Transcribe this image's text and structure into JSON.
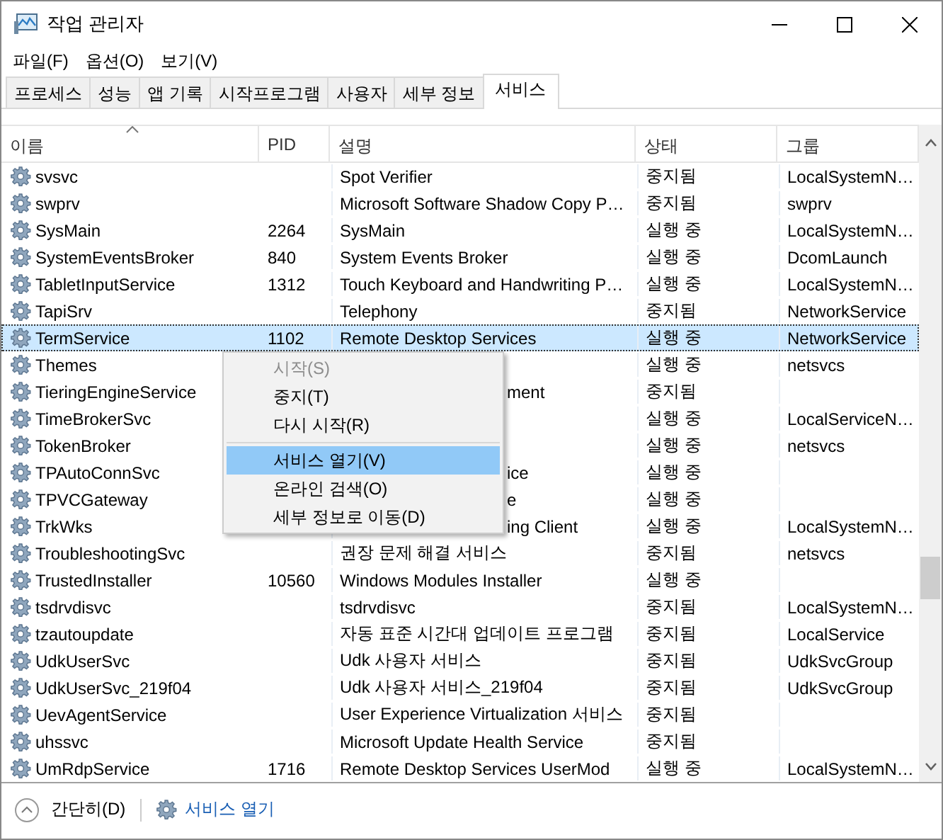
{
  "window": {
    "title": "작업 관리자"
  },
  "menu_bar": [
    "파일(F)",
    "옵션(O)",
    "보기(V)"
  ],
  "tabs": [
    {
      "label": "프로세스",
      "selected": false
    },
    {
      "label": "성능",
      "selected": false
    },
    {
      "label": "앱 기록",
      "selected": false
    },
    {
      "label": "시작프로그램",
      "selected": false
    },
    {
      "label": "사용자",
      "selected": false
    },
    {
      "label": "세부 정보",
      "selected": false
    },
    {
      "label": "서비스",
      "selected": true
    }
  ],
  "table": {
    "columns": [
      "이름",
      "PID",
      "설명",
      "상태",
      "그룹"
    ],
    "rows": [
      {
        "name": "svsvc",
        "pid": "",
        "description": "Spot Verifier",
        "status": "중지됨",
        "group": "LocalSystemN…",
        "selected": false
      },
      {
        "name": "swprv",
        "pid": "",
        "description": "Microsoft Software Shadow Copy P…",
        "status": "중지됨",
        "group": "swprv",
        "selected": false
      },
      {
        "name": "SysMain",
        "pid": "2264",
        "description": "SysMain",
        "status": "실행 중",
        "group": "LocalSystemN…",
        "selected": false
      },
      {
        "name": "SystemEventsBroker",
        "pid": "840",
        "description": "System Events Broker",
        "status": "실행 중",
        "group": "DcomLaunch",
        "selected": false
      },
      {
        "name": "TabletInputService",
        "pid": "1312",
        "description": "Touch Keyboard and Handwriting P…",
        "status": "실행 중",
        "group": "LocalSystemN…",
        "selected": false
      },
      {
        "name": "TapiSrv",
        "pid": "",
        "description": "Telephony",
        "status": "중지됨",
        "group": "NetworkService",
        "selected": false
      },
      {
        "name": "TermService",
        "pid": "1102",
        "description": "Remote Desktop Services",
        "status": "실행 중",
        "group": "NetworkService",
        "selected": true
      },
      {
        "name": "Themes",
        "pid": "",
        "description": "",
        "status": "실행 중",
        "group": "netsvcs",
        "selected": false
      },
      {
        "name": "TieringEngineService",
        "pid": "",
        "description": "ment",
        "description_cut": true,
        "status": "중지됨",
        "group": "",
        "selected": false
      },
      {
        "name": "TimeBrokerSvc",
        "pid": "",
        "description": "",
        "status": "실행 중",
        "group": "LocalServiceN…",
        "selected": false
      },
      {
        "name": "TokenBroker",
        "pid": "",
        "description": "",
        "status": "실행 중",
        "group": "netsvcs",
        "selected": false
      },
      {
        "name": "TPAutoConnSvc",
        "pid": "",
        "description": "ice",
        "description_cut": true,
        "status": "실행 중",
        "group": "",
        "selected": false
      },
      {
        "name": "TPVCGateway",
        "pid": "",
        "description": "e",
        "description_cut": true,
        "status": "실행 중",
        "group": "",
        "selected": false
      },
      {
        "name": "TrkWks",
        "pid": "",
        "description": "ing Client",
        "description_cut": true,
        "status": "실행 중",
        "group": "LocalSystemN…",
        "selected": false
      },
      {
        "name": "TroubleshootingSvc",
        "pid": "",
        "description": "권장 문제 해결 서비스",
        "status": "중지됨",
        "group": "netsvcs",
        "selected": false
      },
      {
        "name": "TrustedInstaller",
        "pid": "10560",
        "description": "Windows Modules Installer",
        "status": "실행 중",
        "group": "",
        "selected": false
      },
      {
        "name": "tsdrvdisvc",
        "pid": "",
        "description": "tsdrvdisvc",
        "status": "중지됨",
        "group": "LocalSystemN…",
        "selected": false
      },
      {
        "name": "tzautoupdate",
        "pid": "",
        "description": "자동 표준 시간대 업데이트 프로그램",
        "status": "중지됨",
        "group": "LocalService",
        "selected": false
      },
      {
        "name": "UdkUserSvc",
        "pid": "",
        "description": "Udk 사용자 서비스",
        "status": "중지됨",
        "group": "UdkSvcGroup",
        "selected": false
      },
      {
        "name": "UdkUserSvc_219f04",
        "pid": "",
        "description": "Udk 사용자 서비스_219f04",
        "status": "중지됨",
        "group": "UdkSvcGroup",
        "selected": false
      },
      {
        "name": "UevAgentService",
        "pid": "",
        "description": "User Experience Virtualization 서비스",
        "status": "중지됨",
        "group": "",
        "selected": false
      },
      {
        "name": "uhssvc",
        "pid": "",
        "description": "Microsoft Update Health Service",
        "status": "중지됨",
        "group": "",
        "selected": false
      },
      {
        "name": "UmRdpService",
        "pid": "1716",
        "description": "Remote Desktop Services UserMod",
        "status": "실행 중",
        "group": "LocalSystemN…",
        "selected": false
      }
    ]
  },
  "context_menu": [
    {
      "kind": "item",
      "label": "시작(S)",
      "disabled": true,
      "selected": false
    },
    {
      "kind": "item",
      "label": "중지(T)",
      "disabled": false,
      "selected": false
    },
    {
      "kind": "item",
      "label": "다시 시작(R)",
      "disabled": false,
      "selected": false
    },
    {
      "kind": "separator"
    },
    {
      "kind": "item",
      "label": "서비스 열기(V)",
      "disabled": false,
      "selected": true
    },
    {
      "kind": "item",
      "label": "온라인 검색(O)",
      "disabled": false,
      "selected": false
    },
    {
      "kind": "item",
      "label": "세부 정보로 이동(D)",
      "disabled": false,
      "selected": false
    }
  ],
  "footer": {
    "collapse_label": "간단히(D)",
    "link": "서비스 열기"
  }
}
